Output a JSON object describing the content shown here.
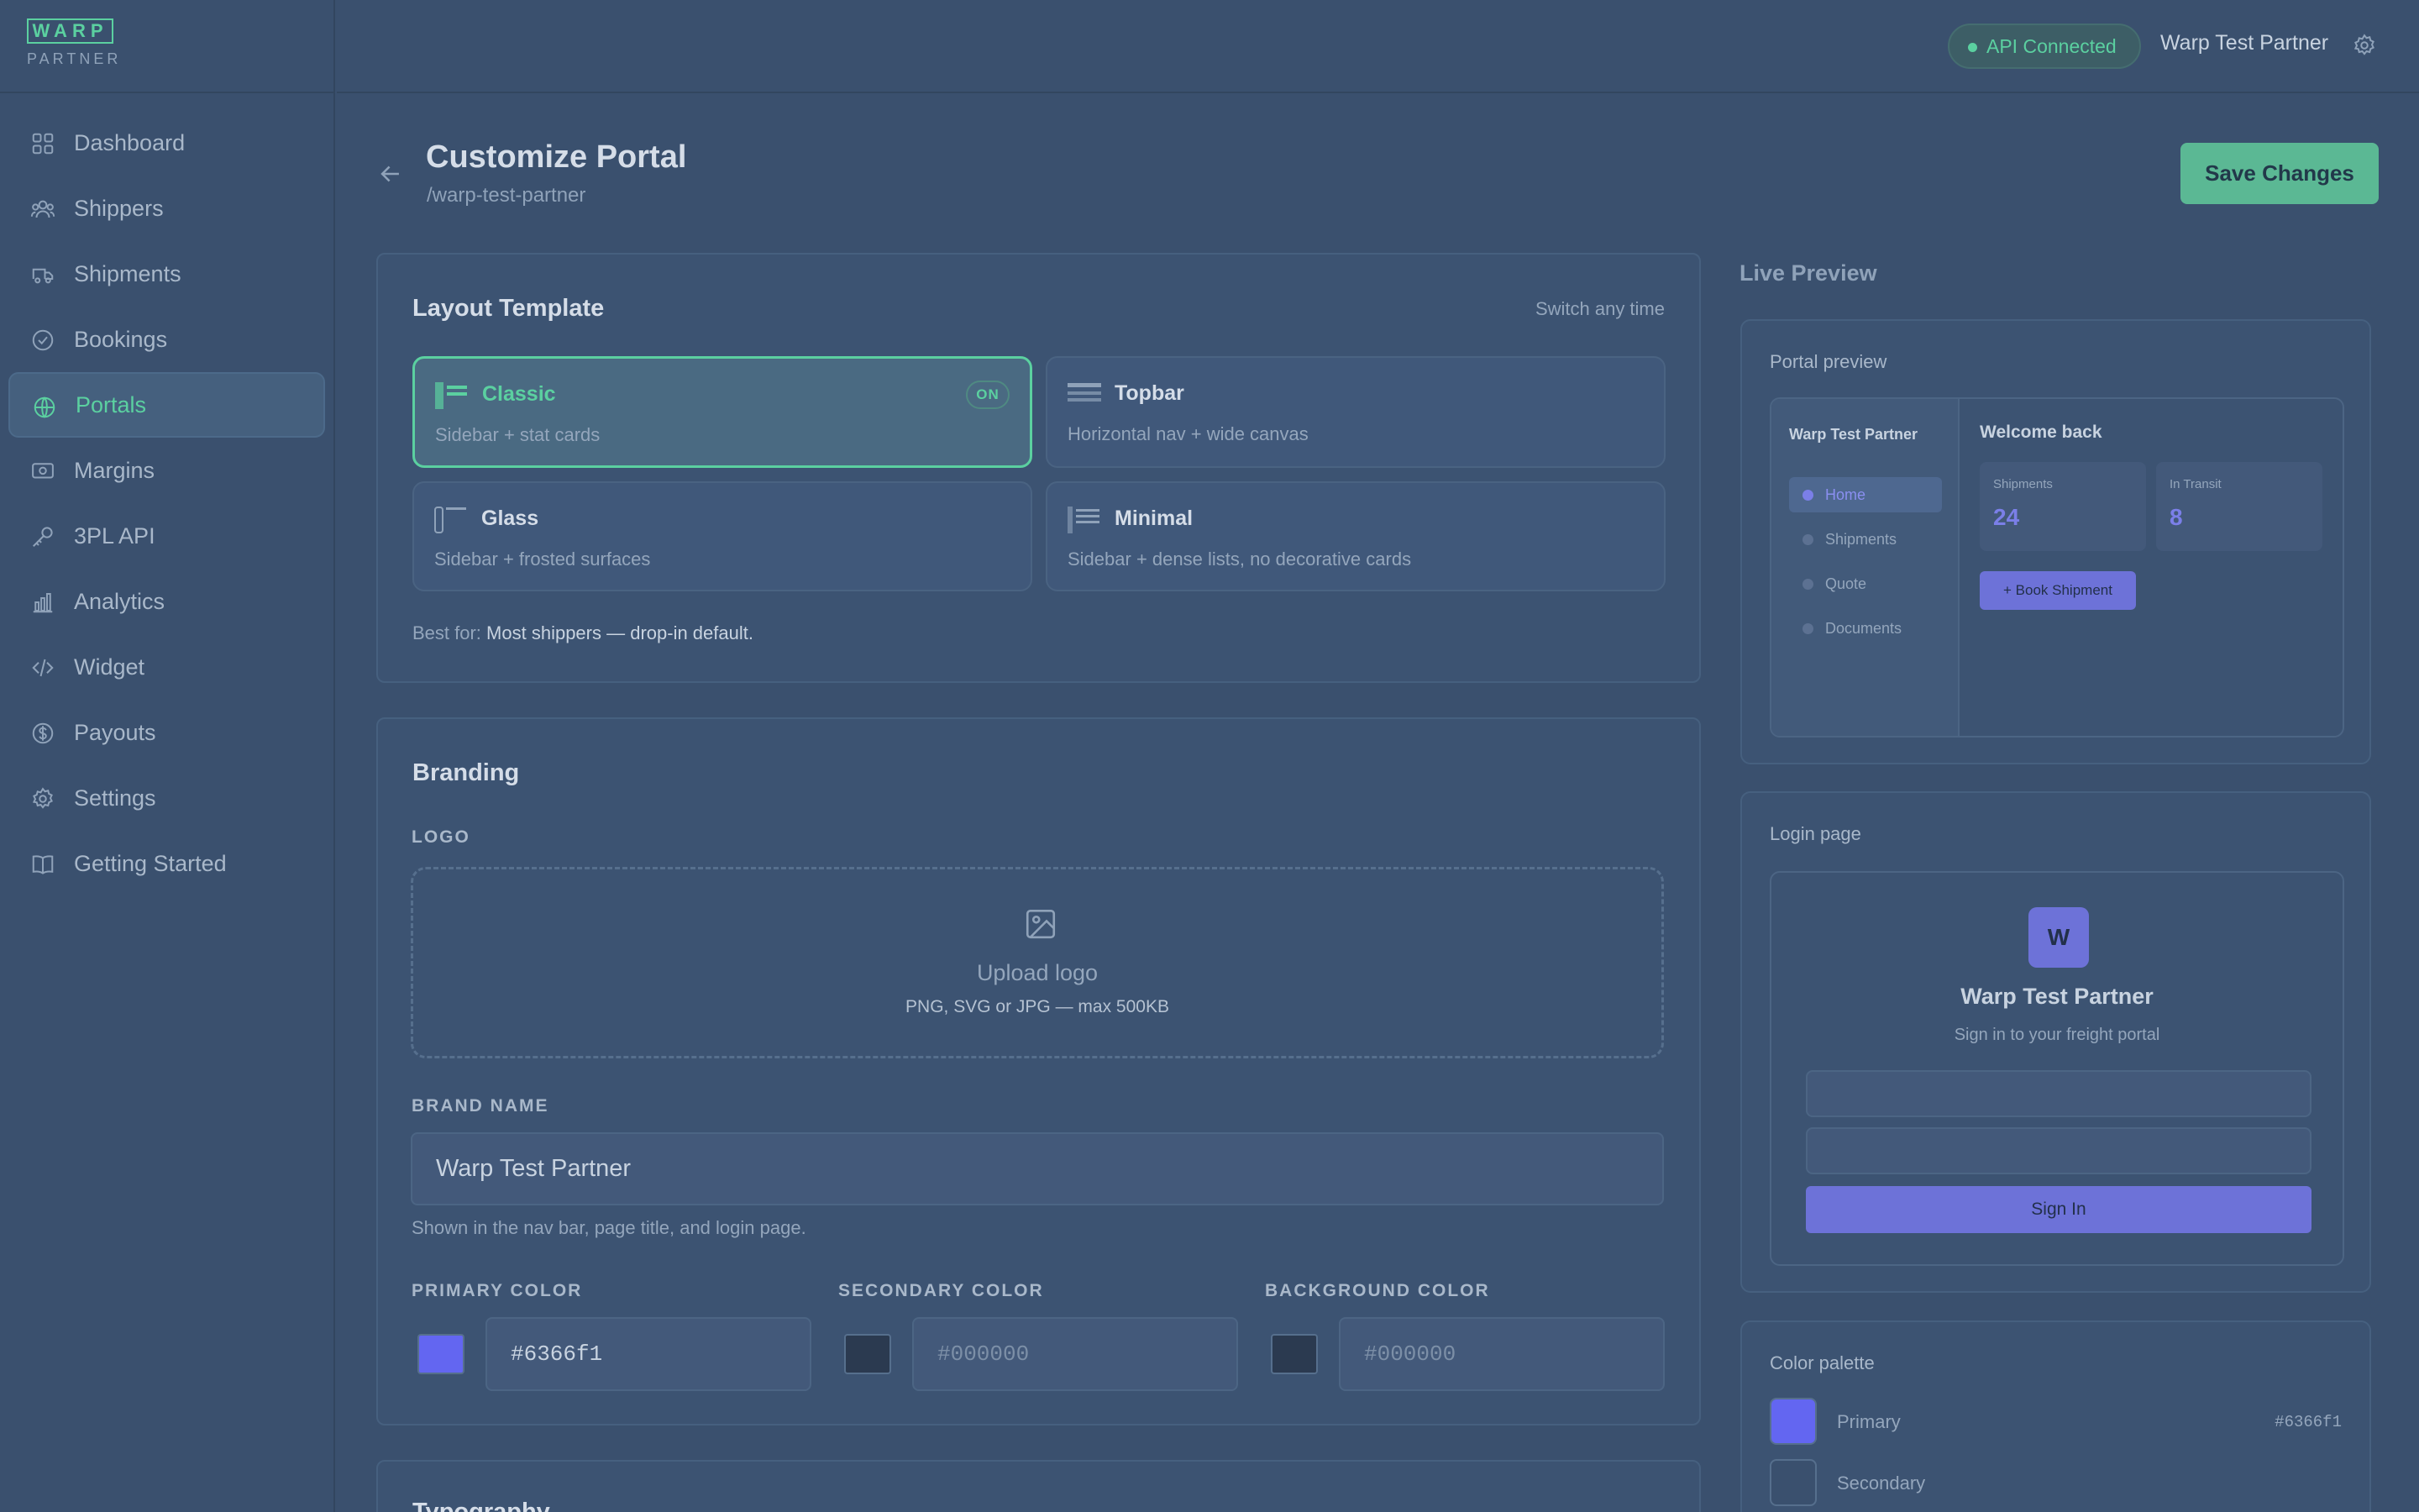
{
  "brand": {
    "logo": "WARP",
    "sub": "PARTNER"
  },
  "nav": [
    {
      "label": "Dashboard",
      "icon": "grid-icon"
    },
    {
      "label": "Shippers",
      "icon": "users-icon"
    },
    {
      "label": "Shipments",
      "icon": "truck-icon"
    },
    {
      "label": "Bookings",
      "icon": "check-circle-icon"
    },
    {
      "label": "Portals",
      "icon": "globe-icon",
      "active": true
    },
    {
      "label": "Margins",
      "icon": "cash-icon"
    },
    {
      "label": "3PL API",
      "icon": "key-icon"
    },
    {
      "label": "Analytics",
      "icon": "bar-chart-icon"
    },
    {
      "label": "Widget",
      "icon": "code-icon"
    },
    {
      "label": "Payouts",
      "icon": "dollar-circle-icon"
    },
    {
      "label": "Settings",
      "icon": "gear-icon"
    },
    {
      "label": "Getting Started",
      "icon": "book-icon"
    }
  ],
  "topbar": {
    "api_status": "API Connected",
    "user": "Warp Test Partner"
  },
  "header": {
    "title": "Customize Portal",
    "slug": "/warp-test-partner",
    "save": "Save Changes"
  },
  "layout": {
    "title": "Layout Template",
    "hint": "Switch any time",
    "templates": [
      {
        "name": "Classic",
        "desc": "Sidebar + stat cards",
        "active": true,
        "badge": "ON"
      },
      {
        "name": "Topbar",
        "desc": "Horizontal nav + wide canvas"
      },
      {
        "name": "Glass",
        "desc": "Sidebar + frosted surfaces"
      },
      {
        "name": "Minimal",
        "desc": "Sidebar + dense lists, no decorative cards"
      }
    ],
    "best_for_label": "Best for:",
    "best_for_value": "Most shippers — drop-in default."
  },
  "branding": {
    "title": "Branding",
    "logo_label": "LOGO",
    "upload_title": "Upload logo",
    "upload_hint": "PNG, SVG or JPG — max 500KB",
    "brand_name_label": "BRAND NAME",
    "brand_name_value": "Warp Test Partner",
    "brand_name_hint": "Shown in the nav bar, page title, and login page.",
    "primary_label": "PRIMARY COLOR",
    "primary_value": "#6366f1",
    "secondary_label": "SECONDARY COLOR",
    "secondary_placeholder": "#000000",
    "background_label": "BACKGROUND COLOR",
    "background_placeholder": "#000000",
    "primary_color": "#6366f1",
    "secondary_color": "#2b3a50",
    "background_color": "#2b3a50"
  },
  "typography": {
    "title": "Typography"
  },
  "preview": {
    "title": "Live Preview",
    "portal_label": "Portal preview",
    "portal": {
      "brand": "Warp Test Partner",
      "nav": [
        "Home",
        "Shipments",
        "Quote",
        "Documents"
      ],
      "welcome": "Welcome back",
      "stats": [
        {
          "label": "Shipments",
          "value": "24"
        },
        {
          "label": "In Transit",
          "value": "8"
        }
      ],
      "cta": "+ Book Shipment"
    },
    "login_label": "Login page",
    "login": {
      "initial": "W",
      "brand": "Warp Test Partner",
      "tagline": "Sign in to your freight portal",
      "button": "Sign In"
    },
    "palette_label": "Color palette",
    "palette": [
      {
        "name": "Primary",
        "hex": "#6366f1",
        "color": "#6366f1"
      },
      {
        "name": "Secondary",
        "hex": "",
        "color": "#3a506e"
      }
    ]
  }
}
